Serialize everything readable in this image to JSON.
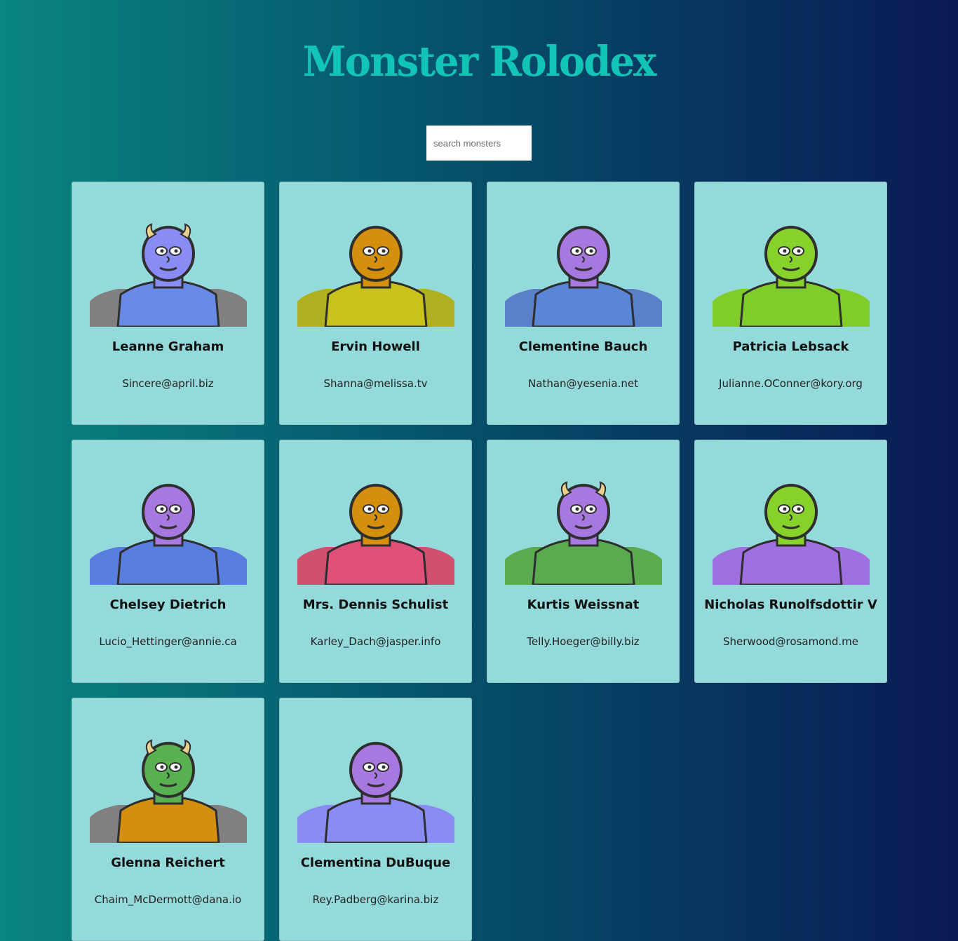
{
  "header": {
    "title": "Monster Rolodex"
  },
  "search": {
    "placeholder": "search monsters",
    "value": ""
  },
  "monsters": [
    {
      "name": "Leanne Graham",
      "email": "Sincere@april.biz",
      "avatar_icon": "monster-avatar-icon",
      "skin": "#8a8cf5",
      "body": "#6a8ae8",
      "shoulder": "#808080",
      "horns": "#e8d08a"
    },
    {
      "name": "Ervin Howell",
      "email": "Shanna@melissa.tv",
      "avatar_icon": "monster-avatar-icon",
      "skin": "#d48f0c",
      "body": "#c9c21a",
      "shoulder": "#b0b020",
      "horns": ""
    },
    {
      "name": "Clementine Bauch",
      "email": "Nathan@yesenia.net",
      "avatar_icon": "monster-avatar-icon",
      "skin": "#a678e0",
      "body": "#5a86d8",
      "shoulder": "#5a80c8",
      "horns": ""
    },
    {
      "name": "Patricia Lebsack",
      "email": "Julianne.OConner@kory.org",
      "avatar_icon": "monster-avatar-icon",
      "skin": "#86d22a",
      "body": "#80cc2a",
      "shoulder": "#80cc2a",
      "horns": ""
    },
    {
      "name": "Chelsey Dietrich",
      "email": "Lucio_Hettinger@annie.ca",
      "avatar_icon": "monster-avatar-icon",
      "skin": "#a678e0",
      "body": "#5a7ee0",
      "shoulder": "#5a7ee0",
      "horns": ""
    },
    {
      "name": "Mrs. Dennis Schulist",
      "email": "Karley_Dach@jasper.info",
      "avatar_icon": "monster-avatar-icon",
      "skin": "#d48f0c",
      "body": "#e05078",
      "shoulder": "#d05070",
      "horns": ""
    },
    {
      "name": "Kurtis Weissnat",
      "email": "Telly.Hoeger@billy.biz",
      "avatar_icon": "monster-avatar-icon",
      "skin": "#a678e0",
      "body": "#5aaa50",
      "shoulder": "#5aaa50",
      "horns": "#e8d08a"
    },
    {
      "name": "Nicholas Runolfsdottir V",
      "email": "Sherwood@rosamond.me",
      "avatar_icon": "monster-avatar-icon",
      "skin": "#86d22a",
      "body": "#a070e0",
      "shoulder": "#a070e0",
      "horns": ""
    },
    {
      "name": "Glenna Reichert",
      "email": "Chaim_McDermott@dana.io",
      "avatar_icon": "monster-avatar-icon",
      "skin": "#58b050",
      "body": "#d48f0c",
      "shoulder": "#808080",
      "horns": "#e8d08a"
    },
    {
      "name": "Clementina DuBuque",
      "email": "Rey.Padberg@karina.biz",
      "avatar_icon": "monster-avatar-icon",
      "skin": "#a678e0",
      "body": "#8a8cf5",
      "shoulder": "#8a8cf5",
      "horns": ""
    }
  ]
}
